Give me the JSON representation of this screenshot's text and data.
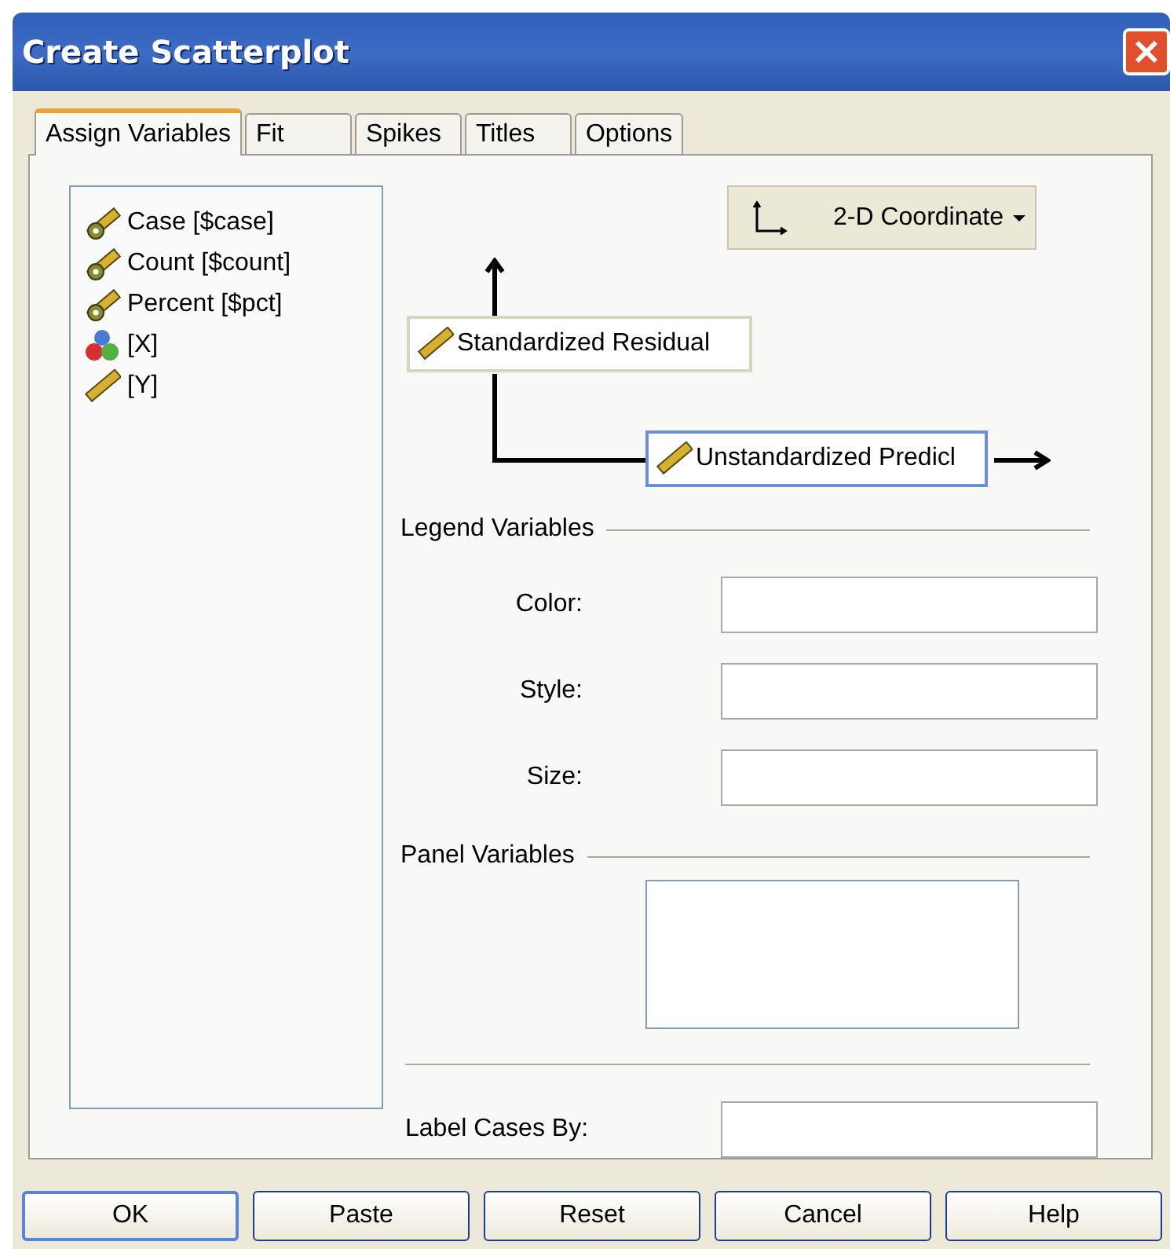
{
  "window": {
    "title": "Create Scatterplot"
  },
  "tabs": [
    {
      "label": "Assign Variables",
      "selected": true
    },
    {
      "label": "Fit",
      "selected": false
    },
    {
      "label": "Spikes",
      "selected": false
    },
    {
      "label": "Titles",
      "selected": false
    },
    {
      "label": "Options",
      "selected": false
    }
  ],
  "variables": [
    {
      "label": "Case [$case]",
      "kind": "system"
    },
    {
      "label": "Count [$count]",
      "kind": "system"
    },
    {
      "label": "Percent [$pct]",
      "kind": "system"
    },
    {
      "label": "[X]",
      "kind": "nominal"
    },
    {
      "label": "[Y]",
      "kind": "scale"
    }
  ],
  "coordinate_button": {
    "label": "2-D Coordinate"
  },
  "axes": [
    {
      "kind": "y",
      "label": "Standardized Residual",
      "selected": false
    },
    {
      "kind": "x",
      "label": "Unstandardized Predicl",
      "selected": true
    }
  ],
  "legend": {
    "heading": "Legend Variables",
    "fields": [
      {
        "label": "Color:"
      },
      {
        "label": "Style:"
      },
      {
        "label": "Size:"
      }
    ]
  },
  "panel": {
    "heading": "Panel Variables"
  },
  "label_cases": {
    "label": "Label Cases By:"
  },
  "buttons": [
    {
      "label": "OK",
      "default": true
    },
    {
      "label": "Paste",
      "default": false
    },
    {
      "label": "Reset",
      "default": false
    },
    {
      "label": "Cancel",
      "default": false
    },
    {
      "label": "Help",
      "default": false
    }
  ]
}
